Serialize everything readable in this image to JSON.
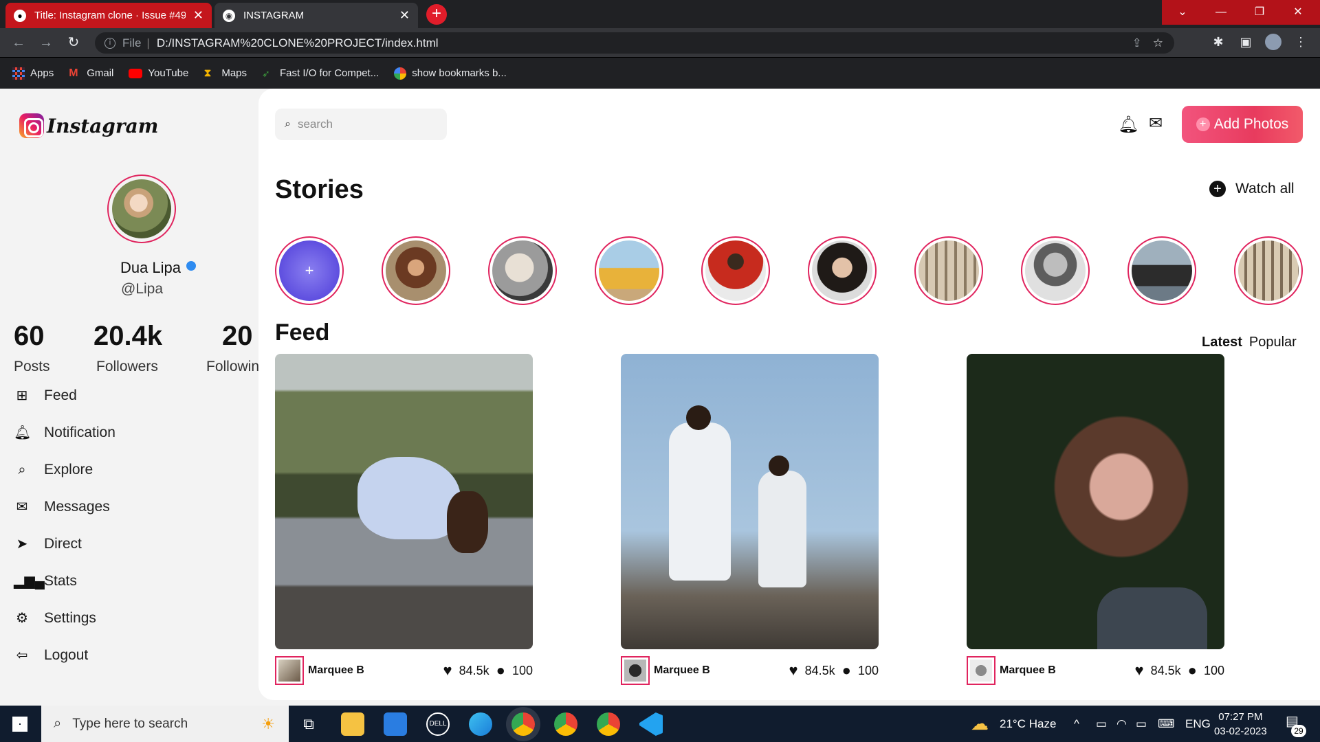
{
  "browser": {
    "tabs": [
      {
        "title": "Title: Instagram clone · Issue #49"
      },
      {
        "title": "INSTAGRAM"
      }
    ],
    "address": {
      "scheme_label": "File",
      "url": "D:/INSTAGRAM%20CLONE%20PROJECT/index.html"
    },
    "bookmarks": [
      {
        "label": "Apps",
        "icon": "apps-grid-icon"
      },
      {
        "label": "Gmail",
        "icon": "gmail-icon"
      },
      {
        "label": "YouTube",
        "icon": "youtube-icon"
      },
      {
        "label": "Maps",
        "icon": "maps-icon"
      },
      {
        "label": "Fast I/O for Compet...",
        "icon": "leaf-icon"
      },
      {
        "label": "show bookmarks b...",
        "icon": "google-icon"
      }
    ]
  },
  "sidebar": {
    "logo_text": "Instagram",
    "profile": {
      "name": "Dua Lipa",
      "handle": "@Lipa"
    },
    "stats": [
      {
        "value": "60",
        "label": "Posts"
      },
      {
        "value": "20.4k",
        "label": "Followers"
      },
      {
        "value": "20",
        "label": "Following"
      }
    ],
    "menu": [
      {
        "label": "Feed",
        "icon": "grid-icon"
      },
      {
        "label": "Notification",
        "icon": "bell-icon"
      },
      {
        "label": "Explore",
        "icon": "explore-search-icon"
      },
      {
        "label": "Messages",
        "icon": "envelope-icon"
      },
      {
        "label": "Direct",
        "icon": "send-icon"
      },
      {
        "label": "Stats",
        "icon": "bar-chart-icon"
      },
      {
        "label": "Settings",
        "icon": "gear-icon"
      },
      {
        "label": "Logout",
        "icon": "logout-icon"
      }
    ]
  },
  "header": {
    "search_placeholder": "search",
    "add_button": "Add Photos"
  },
  "stories": {
    "title": "Stories",
    "watch_all": "Watch all",
    "add_symbol": "+"
  },
  "feed": {
    "title": "Feed",
    "tabs": {
      "latest": "Latest",
      "popular": "Popular"
    },
    "posts": [
      {
        "user": "Marquee B",
        "likes": "84.5k",
        "comments": "100"
      },
      {
        "user": "Marquee B",
        "likes": "84.5k",
        "comments": "100"
      },
      {
        "user": "Marquee B",
        "likes": "84.5k",
        "comments": "100"
      }
    ]
  },
  "taskbar": {
    "search_placeholder": "Type here to search",
    "weather": "21°C  Haze",
    "lang": "ENG",
    "time": "07:27 PM",
    "date": "03-02-2023",
    "notif_count": "29"
  },
  "colors": {
    "accent": "#e0245e",
    "button_gradient_start": "#f2547d",
    "button_gradient_end": "#f25a6a"
  }
}
